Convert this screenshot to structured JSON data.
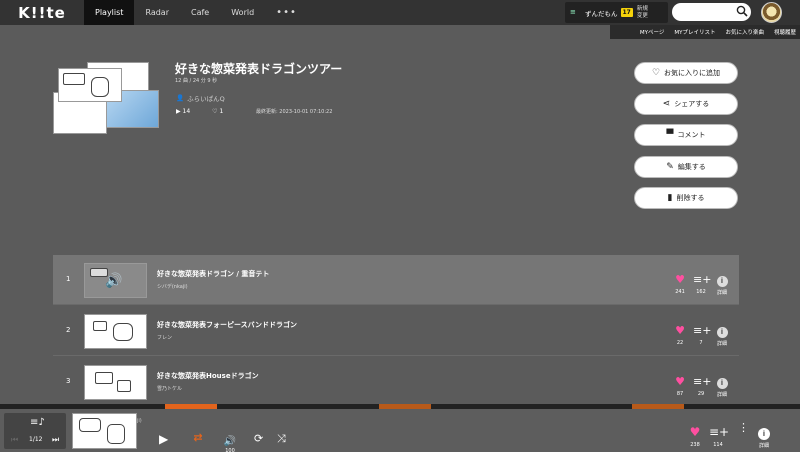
{
  "app": {
    "logo": "K!!te"
  },
  "nav": {
    "tabs": [
      "Playlist",
      "Radar",
      "Cafe",
      "World"
    ],
    "more": "•••"
  },
  "user": {
    "name": "ずんだもん",
    "badge": "17",
    "change_label": "新規\n変更"
  },
  "search": {
    "placeholder": ""
  },
  "subnav": [
    "MYページ",
    "MYプレイリスト",
    "お気に入り楽曲",
    "視聴履歴"
  ],
  "playlist": {
    "title": "好きな惣菜発表ドラゴンツアー",
    "meta": "12 曲 / 24 分 9 秒",
    "creator": "ふらいぱんQ",
    "plays": "14",
    "likes": "1",
    "updated": "最終更新: 2023-10-01 07:10:22"
  },
  "actions": [
    {
      "label": "お気に入りに追加",
      "icon": "heart-outline-icon"
    },
    {
      "label": "シェアする",
      "icon": "share-icon"
    },
    {
      "label": "コメント",
      "icon": "comment-icon"
    },
    {
      "label": "編集する",
      "icon": "pencil-icon"
    },
    {
      "label": "削除する",
      "icon": "trash-icon"
    }
  ],
  "tracks": [
    {
      "num": "1",
      "title": "好きな惣菜発表ドラゴン / 重音テト",
      "artist": "シバデ(nkaji)",
      "likes": "241",
      "adds": "162",
      "detail": "詳細"
    },
    {
      "num": "2",
      "title": "好きな惣菜発表フォーピースバンドドラゴン",
      "artist": "フレン",
      "likes": "22",
      "adds": "7",
      "detail": "詳細"
    },
    {
      "num": "3",
      "title": "好きな惣菜発表Houseドラゴン",
      "artist": "雪乃トケル",
      "likes": "87",
      "adds": "29",
      "detail": "詳細"
    }
  ],
  "player": {
    "queue": "1/12",
    "thumb_label": "ji)",
    "volume": "100",
    "likes": "238",
    "adds": "114",
    "detail": "詳細"
  },
  "colors": {
    "accent": "#e2641d",
    "like": "#ff4fa0",
    "badge": "#f5d20a"
  }
}
